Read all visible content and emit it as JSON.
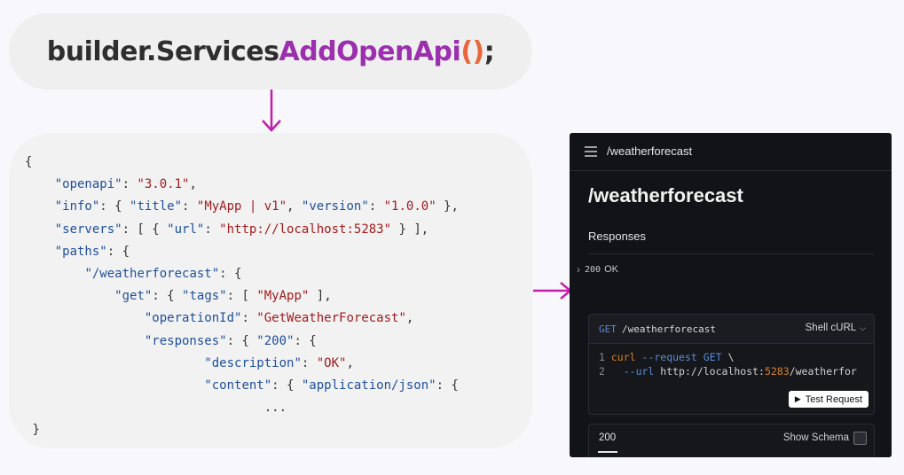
{
  "top_code": {
    "object": "builder.Services",
    "method": "AddOpenApi",
    "parens": "()",
    "semicolon": ";"
  },
  "openapi_json": {
    "line1": "{",
    "openapi_key": "\"openapi\"",
    "openapi_val": "\"3.0.1\"",
    "info_key": "\"info\"",
    "title_key": "\"title\"",
    "title_val": "\"MyApp | v1\"",
    "version_key": "\"version\"",
    "version_val": "\"1.0.0\"",
    "servers_key": "\"servers\"",
    "url_key": "\"url\"",
    "url_val": "\"http://localhost:5283\"",
    "paths_key": "\"paths\"",
    "path_key": "\"/weatherforecast\"",
    "get_key": "\"get\"",
    "tags_key": "\"tags\"",
    "tags_val": "\"MyApp\"",
    "opid_key": "\"operationId\"",
    "opid_val": "\"GetWeatherForecast\"",
    "responses_key": "\"responses\"",
    "code_200": "\"200\"",
    "desc_key": "\"description\"",
    "desc_val": "\"OK\"",
    "content_key": "\"content\"",
    "content_val": "\"application/json\"",
    "ellipsis": "...",
    "closing": "}"
  },
  "panel": {
    "topbar_title": "/weatherforecast",
    "page_title": "/weatherforecast",
    "responses_heading": "Responses",
    "response_code": "200",
    "response_text": "OK",
    "request": {
      "method": "GET",
      "path": "/weatherforecast",
      "language": "Shell cURL",
      "line1_no": "1",
      "line1_cmd": "curl",
      "line1_flag": "--request",
      "line1_method": "GET",
      "line1_cont": "\\",
      "line2_no": "2",
      "line2_flag": "--url",
      "line2_host": "http://localhost:",
      "line2_port": "5283",
      "line2_path": "/weatherfor",
      "test_button": "Test Request"
    },
    "tab_label": "200",
    "show_schema_label": "Show Schema"
  },
  "colors": {
    "method": "#9b2fae",
    "parens": "#e8663a",
    "arrow": "#c21fa8",
    "json_key": "#1f4f9a",
    "json_string": "#a21b1b",
    "panel_bg": "#111317"
  },
  "icons": [
    "down-arrow",
    "right-arrow",
    "menu-icon",
    "chevron-right-icon",
    "chevron-down-icon",
    "play-icon",
    "checkbox"
  ]
}
